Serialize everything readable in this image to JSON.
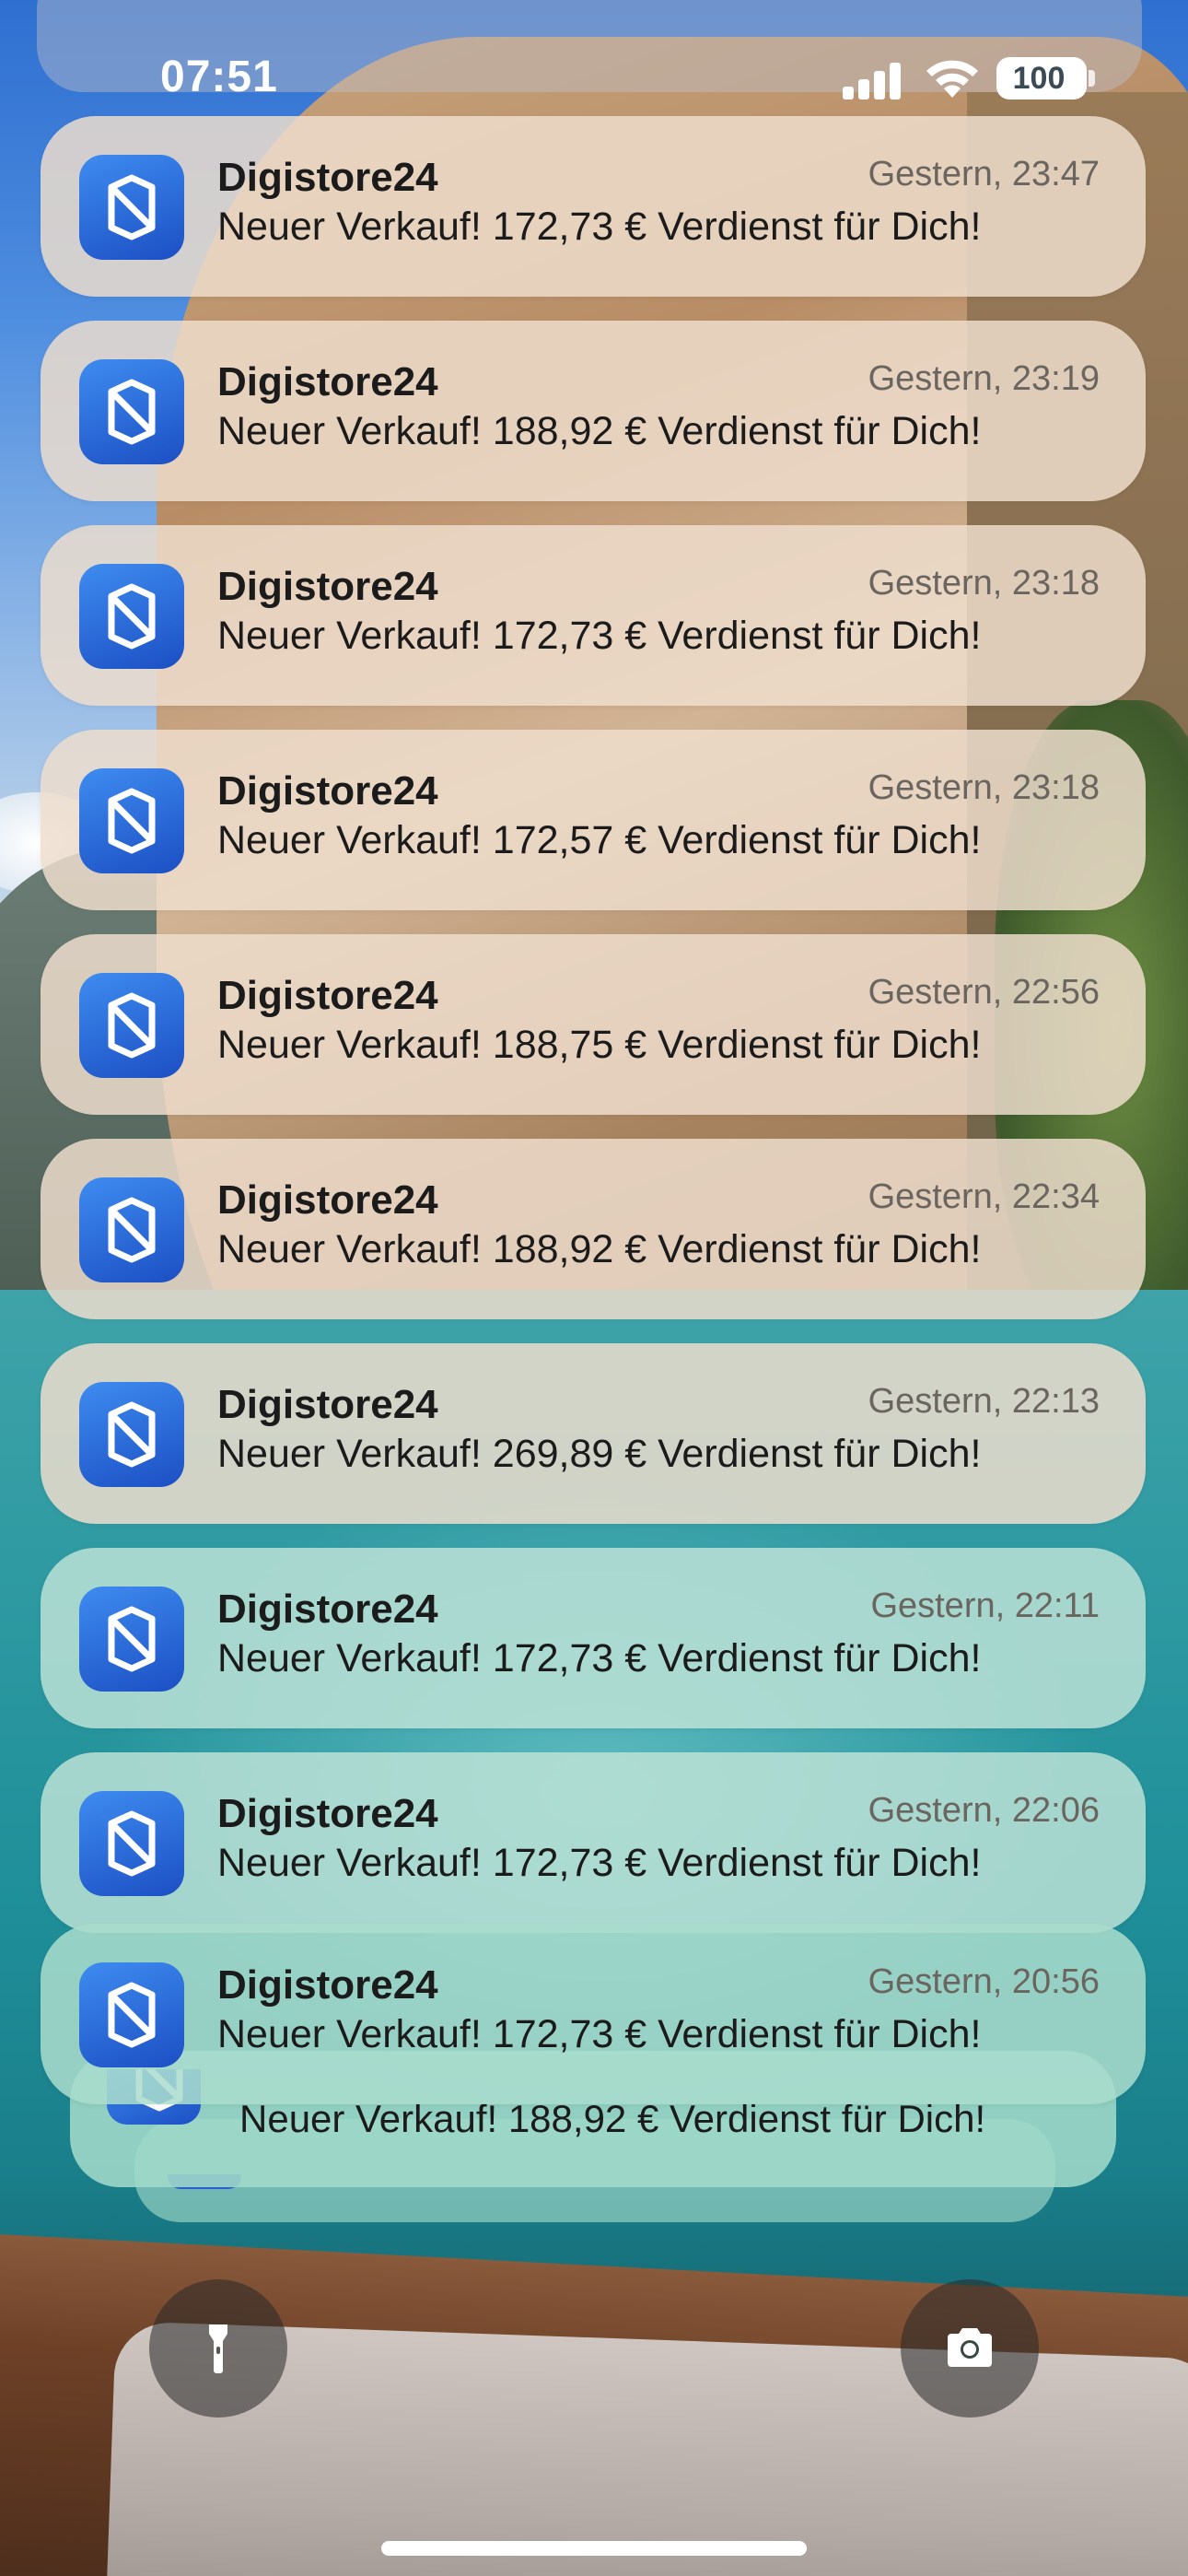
{
  "status_bar": {
    "time": "07:51",
    "battery": "100",
    "signal_icon": "cellular-signal-icon",
    "wifi_icon": "wifi-icon"
  },
  "notifications": [
    {
      "app": "Digistore24",
      "time": "Gestern, 23:47",
      "body": "Neuer Verkauf! 172,73 € Verdienst für Dich!"
    },
    {
      "app": "Digistore24",
      "time": "Gestern, 23:19",
      "body": "Neuer Verkauf! 188,92 € Verdienst für Dich!"
    },
    {
      "app": "Digistore24",
      "time": "Gestern, 23:18",
      "body": "Neuer Verkauf! 172,73 € Verdienst für Dich!"
    },
    {
      "app": "Digistore24",
      "time": "Gestern, 23:18",
      "body": "Neuer Verkauf! 172,57 € Verdienst für Dich!"
    },
    {
      "app": "Digistore24",
      "time": "Gestern, 22:56",
      "body": "Neuer Verkauf! 188,75 € Verdienst für Dich!"
    },
    {
      "app": "Digistore24",
      "time": "Gestern, 22:34",
      "body": "Neuer Verkauf! 188,92 € Verdienst für Dich!"
    },
    {
      "app": "Digistore24",
      "time": "Gestern, 22:13",
      "body": "Neuer Verkauf! 269,89 € Verdienst für Dich!"
    },
    {
      "app": "Digistore24",
      "time": "Gestern, 22:11",
      "body": "Neuer Verkauf! 172,73 € Verdienst für Dich!"
    },
    {
      "app": "Digistore24",
      "time": "Gestern, 22:06",
      "body": "Neuer Verkauf! 172,73 € Verdienst für Dich!"
    },
    {
      "app": "Digistore24",
      "time": "Gestern, 20:56",
      "body": "Neuer Verkauf! 172,73 € Verdienst für Dich!"
    }
  ],
  "stacked_notification": {
    "body": "Neuer Verkauf! 188,92 € Verdienst für Dich!"
  },
  "controls": {
    "flashlight_icon": "flashlight-icon",
    "camera_icon": "camera-icon"
  },
  "colors": {
    "app_icon_top": "#3e8cf0",
    "app_icon_bottom": "#1c4fc4"
  }
}
